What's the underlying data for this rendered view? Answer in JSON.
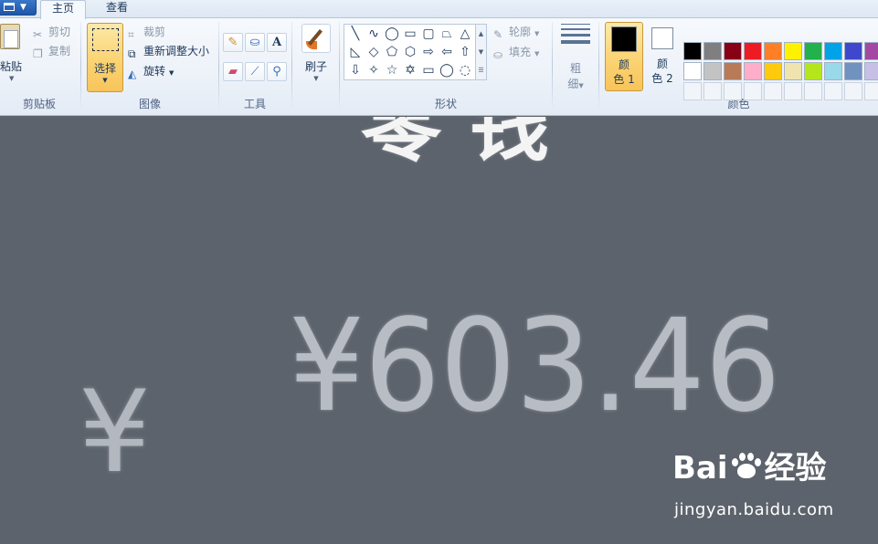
{
  "tabs": [
    "主页",
    "查看"
  ],
  "clipboard": {
    "paste": "粘贴",
    "cut": "剪切",
    "copy": "复制",
    "group": "剪贴板"
  },
  "image": {
    "select": "选择",
    "crop": "裁剪",
    "resize": "重新调整大小",
    "rotate": "旋转",
    "group": "图像"
  },
  "tools": {
    "group": "工具",
    "text_tool": "A",
    "items": [
      "pencil-icon",
      "fill-icon",
      "text-icon",
      "eraser-icon",
      "color-picker-icon",
      "magnifier-icon"
    ]
  },
  "brush": {
    "label": "刷子"
  },
  "shapes": {
    "outline": "轮廓",
    "fill": "填充",
    "group": "形状",
    "glyphs": [
      "╲",
      "∿",
      "◯",
      "▭",
      "▢",
      "⏢",
      "△",
      "◺",
      "◇",
      "⬠",
      "⬡",
      "⇨",
      "⇦",
      "⇧",
      "⇩",
      "✧",
      "☆",
      "✡",
      "▭",
      "◯",
      "◌"
    ]
  },
  "size": {
    "line1": "粗",
    "line2": "细"
  },
  "colors": {
    "color1": {
      "line1": "颜",
      "line2": "色 1",
      "value": "#000000"
    },
    "color2": {
      "line1": "颜",
      "line2": "色 2",
      "value": "#ffffff"
    },
    "group": "颜色",
    "palette_row1": [
      "#000000",
      "#7f7f7f",
      "#880015",
      "#ed1c24",
      "#ff7f27",
      "#fff200",
      "#22b14c",
      "#00a2e8",
      "#3f48cc",
      "#a349a4"
    ],
    "palette_row2": [
      "#ffffff",
      "#c3c3c3",
      "#b97a57",
      "#ffaec9",
      "#ffc90e",
      "#efe4b0",
      "#b5e61d",
      "#99d9ea",
      "#7092be",
      "#c8bfe7"
    ]
  },
  "canvas": {
    "title": "零钱",
    "amount": "¥603.46",
    "yen": "¥"
  },
  "watermark": {
    "brand_left": "Bai",
    "brand_right": "经验",
    "url": "jingyan.baidu.com"
  }
}
